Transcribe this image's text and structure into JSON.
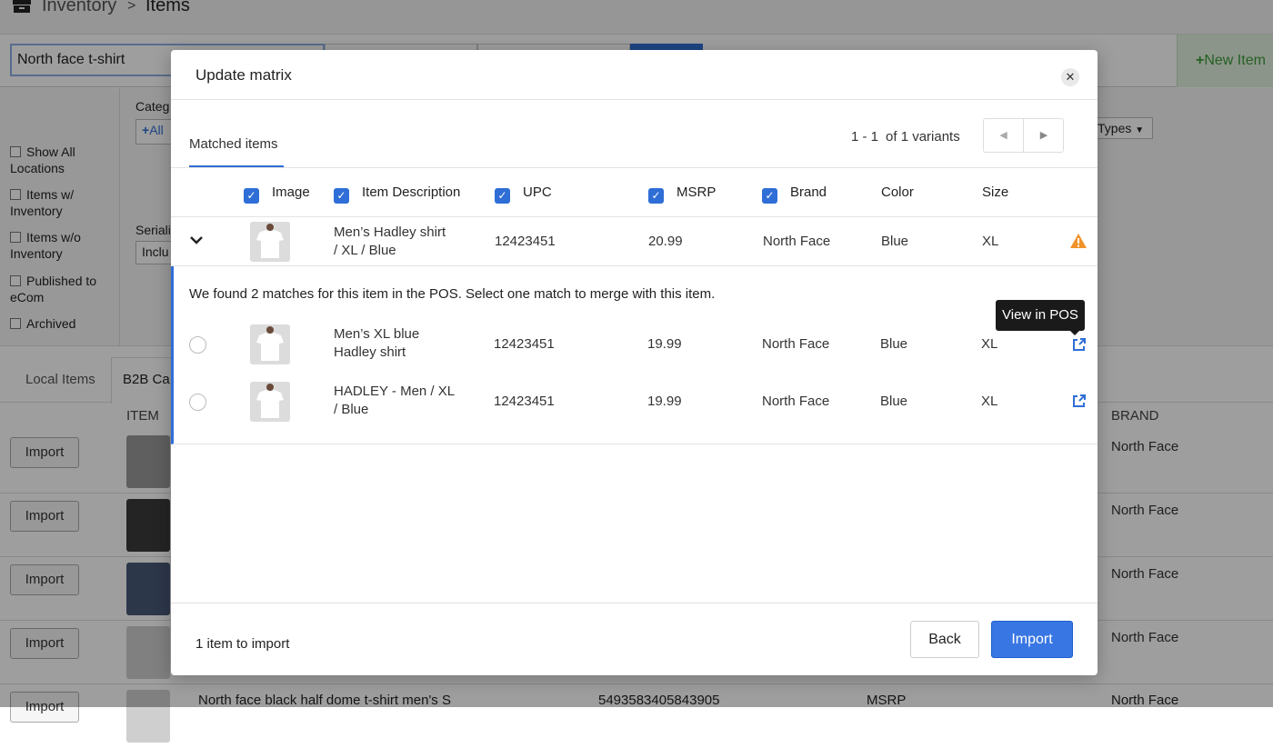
{
  "background": {
    "breadcrumb": {
      "section": "Inventory",
      "separator": ">",
      "page": "Items"
    },
    "search": {
      "value": "North face t-shirt"
    },
    "new_item_label": "New Item",
    "filters": {
      "checkboxes": [
        {
          "label": "Show All Locations"
        },
        {
          "label": "Items w/ Inventory"
        },
        {
          "label": "Items w/o Inventory"
        },
        {
          "label": "Published to eCom"
        },
        {
          "label": "Archived"
        }
      ],
      "category_label": "Categ",
      "category_button": "All",
      "serial_label": "Seriali",
      "serial_select": "Inclu",
      "types_select": "Types"
    },
    "tabs": {
      "local": "Local Items",
      "b2b": "B2B Ca"
    },
    "columns": {
      "item": "ITEM",
      "brand": "BRAND"
    },
    "rows": [
      {
        "button": "Import",
        "brand": "North Face"
      },
      {
        "button": "Import",
        "brand": "North Face"
      },
      {
        "button": "Import",
        "brand": "North Face"
      },
      {
        "button": "Import",
        "brand": "North Face"
      },
      {
        "button": "Import",
        "description": "North face black half dome t-shirt men's S",
        "upc": "5493583405843905",
        "msrp": "MSRP",
        "brand": "North Face"
      }
    ]
  },
  "modal": {
    "title": "Update matrix",
    "tab_label": "Matched items",
    "pager": {
      "range": "1 - 1",
      "total": "of 1 variants"
    },
    "columns": {
      "image": "Image",
      "description": "Item Description",
      "upc": "UPC",
      "msrp": "MSRP",
      "brand": "Brand",
      "color": "Color",
      "size": "Size"
    },
    "main_item": {
      "description_line1": "Men’s Hadley shirt",
      "description_line2": "/ XL / Blue",
      "upc": "12423451",
      "msrp": "20.99",
      "brand": "North Face",
      "color": "Blue",
      "size": "XL"
    },
    "match_message": "We found 2 matches for this item in the POS. Select one match to merge with this item.",
    "matches": [
      {
        "description_line1": "Men’s XL blue",
        "description_line2": "Hadley shirt",
        "upc": "12423451",
        "msrp": "19.99",
        "brand": "North Face",
        "color": "Blue",
        "size": "XL"
      },
      {
        "description_line1": "HADLEY - Men / XL",
        "description_line2": "/ Blue",
        "upc": "12423451",
        "msrp": "19.99",
        "brand": "North Face",
        "color": "Blue",
        "size": "XL"
      }
    ],
    "tooltip": "View in POS",
    "footer": {
      "count_text": "1 item to import",
      "back_label": "Back",
      "import_label": "Import"
    },
    "colors": {
      "accent": "#3876e3",
      "warning": "#f0932b",
      "overlay": "rgba(0,0,0,0.38)"
    }
  }
}
